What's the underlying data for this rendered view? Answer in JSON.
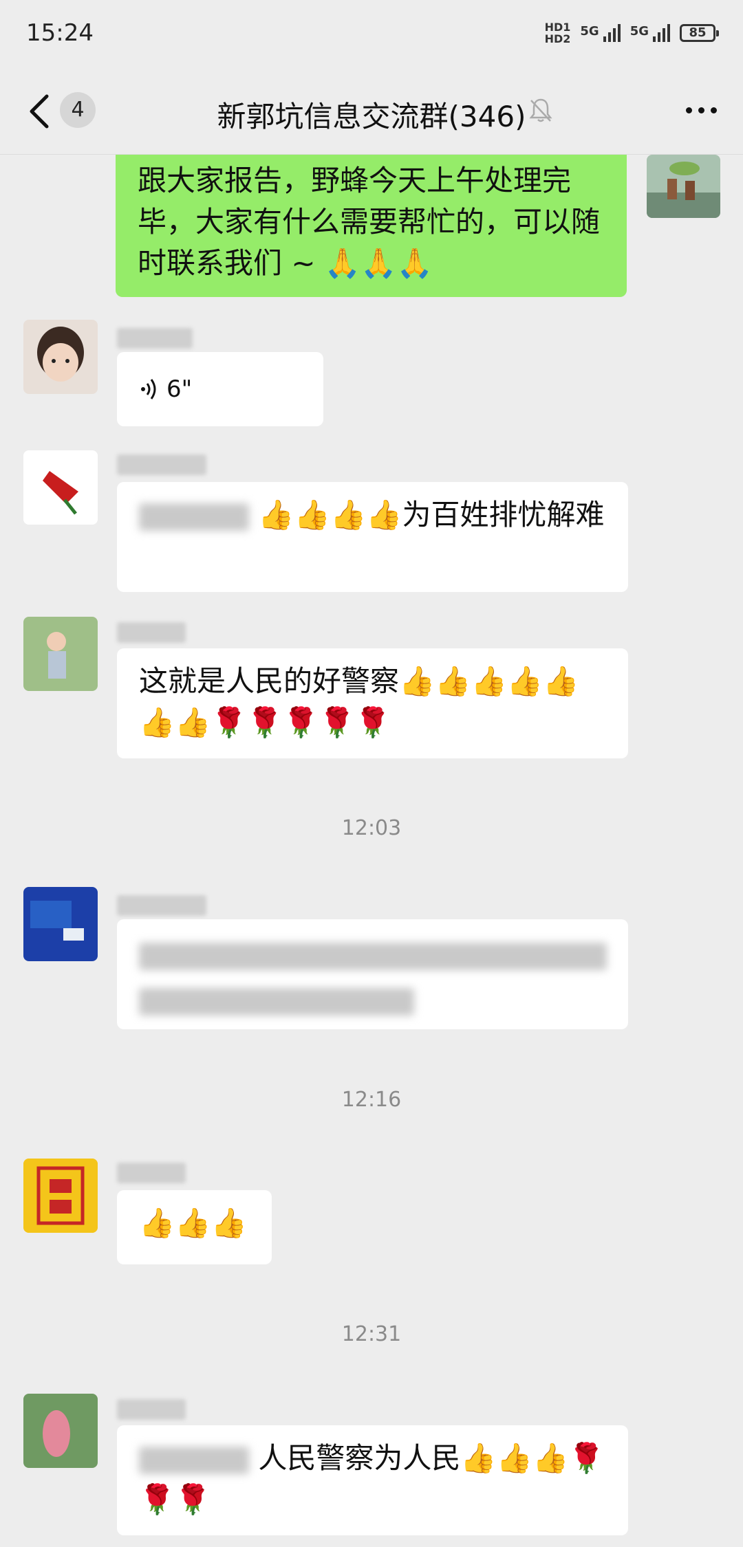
{
  "status_bar": {
    "time": "15:24",
    "network": [
      "HD1",
      "HD2"
    ],
    "signal": [
      "5G",
      "5G"
    ],
    "battery": "85"
  },
  "header": {
    "unread_count": "4",
    "title": "新郭坑信息交流群(346)"
  },
  "messages": [
    {
      "sender": "self",
      "text": "跟大家报告，野蜂今天上午处理完毕，大家有什么需要帮忙的，可以随时联系我们 ~ 🙏🙏🙏"
    },
    {
      "sender": "other",
      "voice_duration": "6\""
    },
    {
      "sender": "other",
      "text": "👍👍👍👍为百姓排忧解难"
    },
    {
      "sender": "other",
      "text": "这就是人民的好警察👍👍👍👍👍👍👍🌹🌹🌹🌹🌹"
    },
    {
      "timestamp": "12:03"
    },
    {
      "sender": "other",
      "text_blurred": true
    },
    {
      "timestamp": "12:16"
    },
    {
      "sender": "other",
      "text": "👍👍👍"
    },
    {
      "timestamp": "12:31"
    },
    {
      "sender": "other",
      "text": "人民警察为人民👍👍👍🌹🌹🌹"
    }
  ],
  "colors": {
    "background": "#ededed",
    "self_bubble": "#95ec69",
    "other_bubble": "#ffffff"
  }
}
